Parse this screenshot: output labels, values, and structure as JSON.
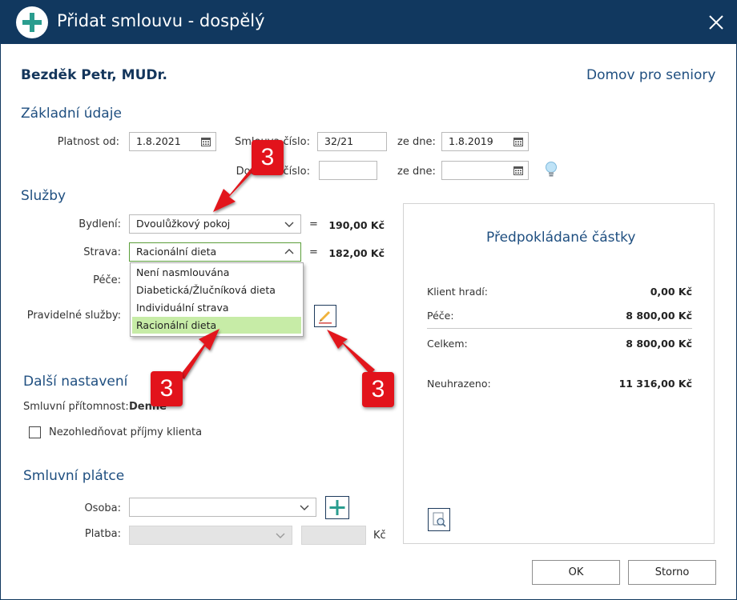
{
  "window": {
    "title": "Přidat smlouvu - dospělý",
    "title_icon": "plus-circle-icon",
    "close_icon": "close-icon"
  },
  "header": {
    "client_name": "Bezděk Petr, MUDr.",
    "facility": "Domov pro seniory"
  },
  "basic_info": {
    "heading": "Základní údaje",
    "valid_from_label": "Platnost od:",
    "valid_from_value": "1.8.2021",
    "contract_no_label": "Smlouva číslo:",
    "contract_no_value": "32/21",
    "date_label": "ze dne:",
    "date_value": "1.8.2019",
    "addendum_label": "Dodatek číslo:",
    "addendum_value": "",
    "addendum_date_label": "ze dne:",
    "addendum_date_value": "",
    "hint_icon": "lightbulb-icon"
  },
  "services": {
    "heading": "Služby",
    "housing_label": "Bydlení:",
    "housing_value": "Dvoulůžkový pokoj",
    "housing_price": "190,00 Kč",
    "food_label": "Strava:",
    "food_value": "Racionální dieta",
    "food_price": "182,00 Kč",
    "equals": "=",
    "care_label": "Péče:",
    "regular_label": "Pravidelné služby:",
    "edit_icon": "pencil-icon",
    "food_options": [
      "Není nasmlouvána",
      "Diabetická/Žlučníková dieta",
      "Individuální strava",
      "Racionální dieta"
    ],
    "food_selected_index": 3
  },
  "other_settings": {
    "heading": "Další nastavení",
    "presence_label": "Smluvní přítomnost:",
    "presence_value": "Denně",
    "ignore_income_label": "Nezohledňovat příjmy klienta",
    "ignore_income_checked": false
  },
  "payer": {
    "heading": "Smluvní plátce",
    "person_label": "Osoba:",
    "person_value": "",
    "add_icon": "plus-icon",
    "payment_label": "Platba:",
    "payment_value": "",
    "amount_value": "",
    "currency": "Kč"
  },
  "summary": {
    "title": "Předpokládané částky",
    "rows": [
      {
        "label": "Klient hradí:",
        "value": "0,00 Kč"
      },
      {
        "label": "Péče:",
        "value": "8 800,00 Kč"
      },
      {
        "label": "Celkem:",
        "value": "8 800,00 Kč"
      },
      {
        "label": "Neuhrazeno:",
        "value": "11 316,00 Kč"
      }
    ],
    "preview_icon": "document-search-icon"
  },
  "buttons": {
    "ok": "OK",
    "cancel": "Storno"
  },
  "annotations": {
    "badge": "3",
    "color": "#e2131b"
  }
}
